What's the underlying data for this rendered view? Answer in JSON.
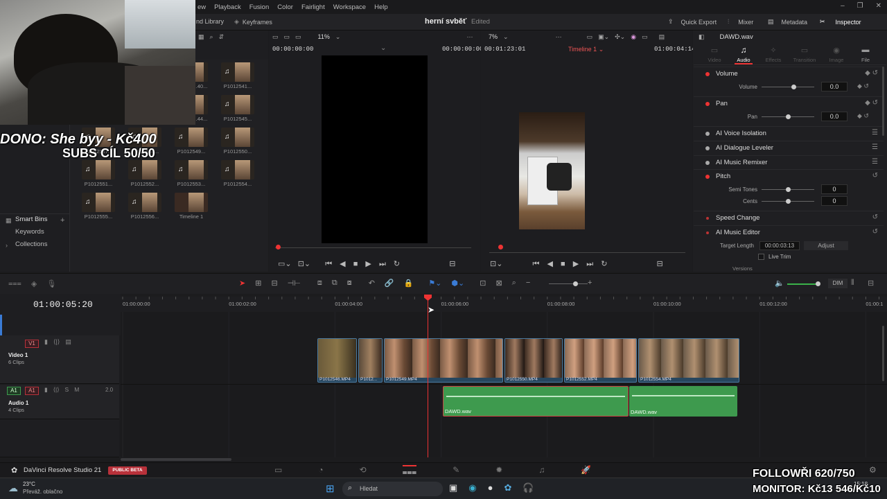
{
  "menu": [
    "ew",
    "Playback",
    "Fusion",
    "Color",
    "Fairlight",
    "Workspace",
    "Help"
  ],
  "header": {
    "media_pool_tab": "nd Library",
    "keyframes": "Keyframes",
    "project": "herní svběť",
    "status": "Edited",
    "quick_export": "Quick Export",
    "mixer": "Mixer",
    "metadata": "Metadata",
    "inspector": "Inspector"
  },
  "toolbar2": {
    "zoom_left": "11%",
    "zoom_mid": "7%",
    "file_name": "DAWD.wav"
  },
  "source_viewer": {
    "tc_left": "00:00:00:00",
    "tc_right": "00:00:00:00"
  },
  "timeline_viewer": {
    "tc_left": "00:01:23:01",
    "timeline_name": "Timeline 1",
    "tc_right": "01:00:04:14"
  },
  "media_pool": {
    "items": [
      {
        "label": "P10125...40...",
        "audio": false
      },
      {
        "label": "P1012541...",
        "audio": true
      },
      {
        "label": "P10125...44...",
        "audio": false
      },
      {
        "label": "P1012545...",
        "audio": true
      },
      {
        "label": "P1012547...",
        "audio": true
      },
      {
        "label": "P1012548...",
        "audio": true
      },
      {
        "label": "P1012549...",
        "audio": true
      },
      {
        "label": "P1012550...",
        "audio": true
      },
      {
        "label": "P1012551...",
        "audio": true
      },
      {
        "label": "P1012552...",
        "audio": true
      },
      {
        "label": "P1012553...",
        "audio": true
      },
      {
        "label": "P1012554...",
        "audio": true
      },
      {
        "label": "P1012555...",
        "audio": true
      },
      {
        "label": "P1012556...",
        "audio": true
      },
      {
        "label": "Timeline 1",
        "audio": false
      }
    ]
  },
  "bins": {
    "smart_bins": "Smart Bins",
    "keywords": "Keywords",
    "collections": "Collections"
  },
  "inspector": {
    "tabs": [
      "Video",
      "Audio",
      "Effects",
      "Transition",
      "Image",
      "File"
    ],
    "active_tab": "Audio",
    "volume": "Volume",
    "volume_label": "Volume",
    "volume_value": "0.0",
    "volume_level": 0.6,
    "pan": "Pan",
    "pan_label": "Pan",
    "pan_value": "0.0",
    "pan_level": 0.5,
    "ai_voice": "AI Voice Isolation",
    "ai_dialogue": "AI Dialogue Leveler",
    "ai_music": "AI Music Remixer",
    "pitch": "Pitch",
    "semi_tones": "Semi Tones",
    "semi_value": "0",
    "cents": "Cents",
    "cents_value": "0",
    "speed_change": "Speed Change",
    "ai_music_editor": "AI Music Editor",
    "target_length": "Target Length",
    "target_value": "00:00:03:13",
    "adjust": "Adjust",
    "live_trim": "Live Trim",
    "versions": "Versions"
  },
  "timeline": {
    "timecode": "01:00:05:20",
    "ruler": [
      "01:00:00:00",
      "01:00:02:00",
      "01:00:04:00",
      "01:00:06:00",
      "01:00:08:00",
      "01:00:10:00",
      "01:00:12:00",
      "01:00:1"
    ],
    "dim": "DIM",
    "video_track": {
      "id": "V1",
      "name": "Video 1",
      "clips": "6 Clips"
    },
    "audio_track": {
      "id": "A1",
      "name": "Audio 1",
      "clips": "4 Clips",
      "level": "2.0"
    },
    "video_clips": [
      "P1012546.MP4",
      "P1012...",
      "P1012549.MP4",
      "P1012550.MP4",
      "P1012552.MP4",
      "P1012554.MP4"
    ],
    "audio_clips": [
      "DAWD.wav",
      "DAWD.wav"
    ]
  },
  "app": {
    "name": "DaVinci Resolve Studio 21",
    "badge": "PUBLIC BETA"
  },
  "taskbar": {
    "temp": "23°C",
    "weather": "Převáž. oblačno",
    "search": "Hledat",
    "time": "15:18"
  },
  "overlay": {
    "dono": "DONO: She byy - Kč400",
    "subs": "SUBS CÍL 50/50",
    "follow": "FOLLOWŘI 620/750",
    "monitor": "MONITOR: Kč13 546/Kč10"
  },
  "colors": {
    "accent_red": "#e33333",
    "video_clip": "#27465e",
    "audio_clip": "#3e9a4e",
    "badge": "#b8313a"
  }
}
